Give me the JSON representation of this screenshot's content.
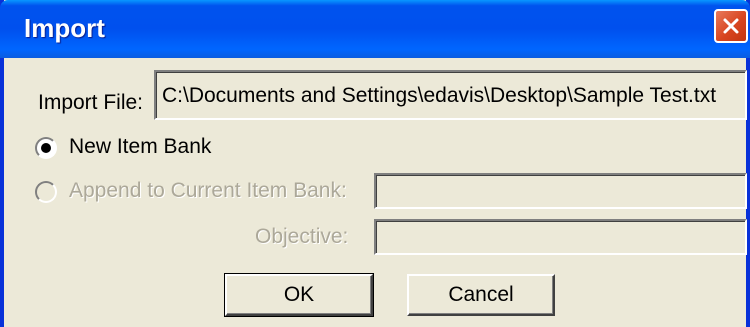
{
  "window": {
    "title": "Import"
  },
  "import_file": {
    "label": "Import File:",
    "value": "C:\\Documents and Settings\\edavis\\Desktop\\Sample Test.txt"
  },
  "options": {
    "new_bank_label": "New Item Bank",
    "new_bank_selected": true,
    "append_label": "Append to Current Item Bank:",
    "append_selected": false,
    "append_enabled": false,
    "append_value": "",
    "objective_label": "Objective:",
    "objective_value": ""
  },
  "buttons": {
    "ok_label": "OK",
    "cancel_label": "Cancel"
  },
  "colors": {
    "titlebar": "#0053EE",
    "close": "#D8451F",
    "face": "#ECE9D8",
    "disabled_text": "#ACA899"
  },
  "icons": {
    "close": "close-icon"
  }
}
